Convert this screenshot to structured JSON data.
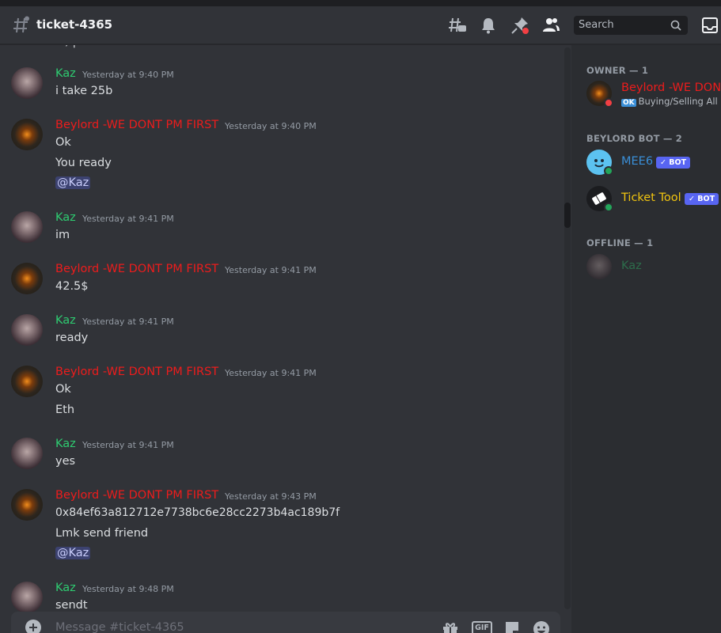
{
  "channel": {
    "name": "ticket-4365"
  },
  "search": {
    "placeholder": "Search"
  },
  "messages": [
    {
      "author": "Kaz",
      "timestamp": "Yesterday at 9:40 PM",
      "lines": [
        "i take 25b"
      ]
    },
    {
      "author": "Beylord  -WE DONT PM FIRST",
      "timestamp": "Yesterday at 9:40 PM",
      "lines": [
        "Ok",
        "You ready"
      ],
      "mention": "@Kaz"
    },
    {
      "author": "Kaz",
      "timestamp": "Yesterday at 9:41 PM",
      "lines": [
        "im"
      ]
    },
    {
      "author": "Beylord  -WE DONT PM FIRST",
      "timestamp": "Yesterday at 9:41 PM",
      "lines": [
        "42.5$"
      ]
    },
    {
      "author": "Kaz",
      "timestamp": "Yesterday at 9:41 PM",
      "lines": [
        "ready"
      ]
    },
    {
      "author": "Beylord  -WE DONT PM FIRST",
      "timestamp": "Yesterday at 9:41 PM",
      "lines": [
        "Ok",
        "Eth"
      ]
    },
    {
      "author": "Kaz",
      "timestamp": "Yesterday at 9:41 PM",
      "lines": [
        "yes"
      ]
    },
    {
      "author": "Beylord  -WE DONT PM FIRST",
      "timestamp": "Yesterday at 9:43 PM",
      "lines": [
        "0x84ef63a812712e7738bc6e28cc2273b4ac189b7f",
        "Lmk send friend"
      ],
      "mention": "@Kaz"
    },
    {
      "author": "Kaz",
      "timestamp": "Yesterday at 9:48 PM",
      "lines": [
        "sendt"
      ]
    }
  ],
  "composer": {
    "placeholder": "Message #ticket-4365",
    "gif_label": "GIF"
  },
  "members": {
    "owner_header": "OWNER — 1",
    "owner": {
      "name": "Beylord  -WE DONT PM FIRST",
      "custom_status_badge": "OK",
      "custom_status": "Buying/Selling All Rs"
    },
    "bot_header": "BEYLORD BOT — 2",
    "bots": [
      {
        "name": "MEE6",
        "tag": "✓ BOT",
        "color": "#3a8fd8"
      },
      {
        "name": "Ticket Tool",
        "tag": "✓ BOT",
        "color": "#f1c40f"
      }
    ],
    "offline_header": "OFFLINE — 1",
    "offline": [
      {
        "name": "Kaz"
      }
    ]
  },
  "colors": {
    "kaz": "#2ecc71",
    "beylord": "#ed1c1c",
    "background": "#313338",
    "sidebar": "#2b2d31"
  }
}
